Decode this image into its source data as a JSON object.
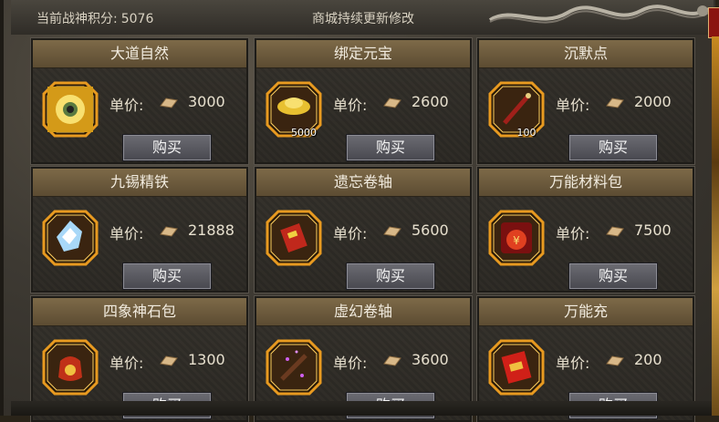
{
  "header": {
    "score_label": "当前战神积分:",
    "score_value": "5076",
    "notice": "商城持续更新修改"
  },
  "shop": {
    "price_label": "单价:",
    "buy_label": "购买",
    "items": [
      {
        "name": "大道自然",
        "price": "3000",
        "icon": "glowing-orb-icon",
        "qty": ""
      },
      {
        "name": "绑定元宝",
        "price": "2600",
        "icon": "gold-ingot-icon",
        "qty": "5000"
      },
      {
        "name": "沉默点",
        "price": "2000",
        "icon": "scroll-red-icon",
        "qty": "100"
      },
      {
        "name": "九锡精铁",
        "price": "21888",
        "icon": "crystal-ore-icon",
        "qty": ""
      },
      {
        "name": "遗忘卷轴",
        "price": "5600",
        "icon": "red-scroll-icon",
        "qty": ""
      },
      {
        "name": "万能材料包",
        "price": "7500",
        "icon": "material-bag-icon",
        "qty": ""
      },
      {
        "name": "四象神石包",
        "price": "1300",
        "icon": "red-pouch-icon",
        "qty": ""
      },
      {
        "name": "虚幻卷轴",
        "price": "3600",
        "icon": "purple-scroll-icon",
        "qty": ""
      },
      {
        "name": "万能充",
        "price": "200",
        "icon": "red-envelope-icon",
        "qty": ""
      }
    ]
  }
}
